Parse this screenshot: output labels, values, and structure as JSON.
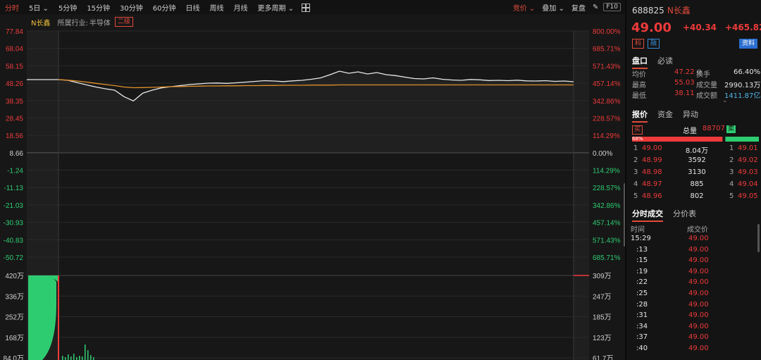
{
  "toolbar": {
    "items": [
      "分时",
      "5日",
      "5分钟",
      "15分钟",
      "30分钟",
      "60分钟",
      "日线",
      "周线",
      "月线",
      "更多周期"
    ],
    "right_items": [
      "竞价",
      "叠加",
      "复盘"
    ],
    "f10_label": "F10"
  },
  "info": {
    "stock_name": "N长鑫",
    "industry_label": "所属行业:",
    "industry_value": "半导体",
    "level": "二级"
  },
  "colors": {
    "up": "#ee3a3a",
    "down": "#2ecc71",
    "price_line": "#e8e8e8",
    "avg_line": "#e0902a",
    "accent": "#e04a3a"
  },
  "chart_data": {
    "type": "line",
    "price_axis_left": [
      "77.84",
      "68.04",
      "58.15",
      "48.26",
      "38.35",
      "28.45",
      "18.56",
      "8.66",
      "-1.24",
      "-11.13",
      "-21.03",
      "-30.93",
      "-40.83",
      "-50.72"
    ],
    "price_axis_right": [
      "800.00%",
      "685.71%",
      "571.43%",
      "457.14%",
      "342.86%",
      "228.57%",
      "114.29%",
      "0.00%",
      "114.29%",
      "228.57%",
      "342.86%",
      "457.14%",
      "571.43%",
      "685.71%"
    ],
    "volume_axis_left": [
      "420万",
      "336万",
      "252万",
      "168万",
      "84.0万"
    ],
    "volume_axis_right": [
      "309万",
      "247万",
      "185万",
      "123万",
      "61.7万"
    ],
    "ylim": [
      -50.72,
      77.84
    ],
    "series": [
      {
        "values": [
          50.2,
          49.8,
          48.5,
          47.2,
          46.0,
          45.0,
          44.2,
          40.5,
          38.1,
          42.5,
          44.2,
          45.5,
          46.2,
          46.8,
          47.4,
          47.8,
          48.2,
          48.3,
          48.1,
          48.4,
          48.8,
          49.2,
          49.6,
          49.4,
          49.1,
          49.5,
          49.8,
          50.4,
          51.2,
          53.0,
          55.0,
          53.8,
          54.6,
          53.4,
          54.2,
          53.0,
          52.5,
          51.6,
          50.8,
          50.6,
          51.2,
          50.4,
          50.0,
          49.8,
          50.3,
          50.1,
          49.7,
          49.8,
          49.6,
          49.9,
          49.5,
          49.4,
          49.6,
          49.2,
          49.4,
          49.0
        ]
      },
      {
        "values": [
          50.2,
          49.9,
          49.4,
          48.8,
          48.1,
          47.4,
          46.8,
          46.0,
          45.6,
          45.7,
          45.8,
          46.0,
          46.2,
          46.3,
          46.4,
          46.5,
          46.6,
          46.6,
          46.7,
          46.7,
          46.8,
          46.8,
          46.9,
          46.9,
          47.0,
          47.0,
          47.0,
          47.1,
          47.1,
          47.1,
          47.2,
          47.2,
          47.2,
          47.2,
          47.2,
          47.2,
          47.2,
          47.2,
          47.2,
          47.2,
          47.2,
          47.2,
          47.2,
          47.2,
          47.2,
          47.2,
          47.2,
          47.2,
          47.2,
          47.2,
          47.2,
          47.2,
          47.2,
          47.2,
          47.2,
          47.22
        ]
      }
    ],
    "volume": [
      420,
      0,
      0,
      0,
      0,
      0,
      0,
      0,
      0,
      0,
      0,
      0,
      0,
      0,
      0,
      0,
      0,
      0,
      0,
      0,
      0,
      0,
      0,
      0,
      0,
      0,
      0,
      0,
      0,
      0,
      0,
      0,
      0,
      0,
      0,
      0,
      0,
      0,
      0,
      0,
      0,
      0,
      0,
      0,
      0,
      0,
      0,
      0,
      0,
      0,
      0,
      0,
      0,
      0,
      0,
      0
    ],
    "grid": true
  },
  "quote": {
    "code": "688825",
    "name": "N长鑫",
    "price": "49.00",
    "change": "+40.34",
    "change_pct": "+465.82",
    "tag_ke": "科",
    "tag_rong": "融",
    "tag_ziliao": "资料"
  },
  "tabs1": [
    "盘口",
    "必读"
  ],
  "stats": [
    {
      "l1": "均价",
      "v1": "47.22",
      "l2": "换手",
      "v2": "66.40%"
    },
    {
      "l1": "最高",
      "v1": "55.03",
      "l2": "成交量",
      "v2": "2990.13万"
    },
    {
      "l1": "最低",
      "v1": "38.11",
      "l2": "成交额",
      "v2": "1411.87亿"
    }
  ],
  "tabs2": [
    "报价",
    "资金",
    "异动"
  ],
  "depth": {
    "buy_label": "买",
    "sell_label": "卖",
    "total_label": "总量",
    "total_value": "88707",
    "pct": "68%",
    "buy_frac": 0.68
  },
  "orders": [
    {
      "idx": "1",
      "bid": "49.00",
      "vol": "8.04万",
      "ask_idx": "1",
      "ask": "49.01"
    },
    {
      "idx": "2",
      "bid": "48.99",
      "vol": "3592",
      "ask_idx": "2",
      "ask": "49.02"
    },
    {
      "idx": "3",
      "bid": "48.98",
      "vol": "3130",
      "ask_idx": "3",
      "ask": "49.03"
    },
    {
      "idx": "4",
      "bid": "48.97",
      "vol": "885",
      "ask_idx": "4",
      "ask": "49.04"
    },
    {
      "idx": "5",
      "bid": "48.96",
      "vol": "802",
      "ask_idx": "5",
      "ask": "49.05"
    }
  ],
  "tabs3": [
    "分时成交",
    "分价表"
  ],
  "ticks_header": {
    "time": "时间",
    "price": "成交价"
  },
  "ticks": [
    {
      "time": "15:29",
      "price": "49.00"
    },
    {
      "time": ":13",
      "price": "49.00"
    },
    {
      "time": ":15",
      "price": "49.00"
    },
    {
      "time": ":19",
      "price": "49.00"
    },
    {
      "time": ":22",
      "price": "49.00"
    },
    {
      "time": ":25",
      "price": "49.00"
    },
    {
      "time": ":28",
      "price": "49.00"
    },
    {
      "time": ":31",
      "price": "49.00"
    },
    {
      "time": ":34",
      "price": "49.00"
    },
    {
      "time": ":37",
      "price": "49.00"
    },
    {
      "time": ":40",
      "price": "49.00"
    }
  ]
}
